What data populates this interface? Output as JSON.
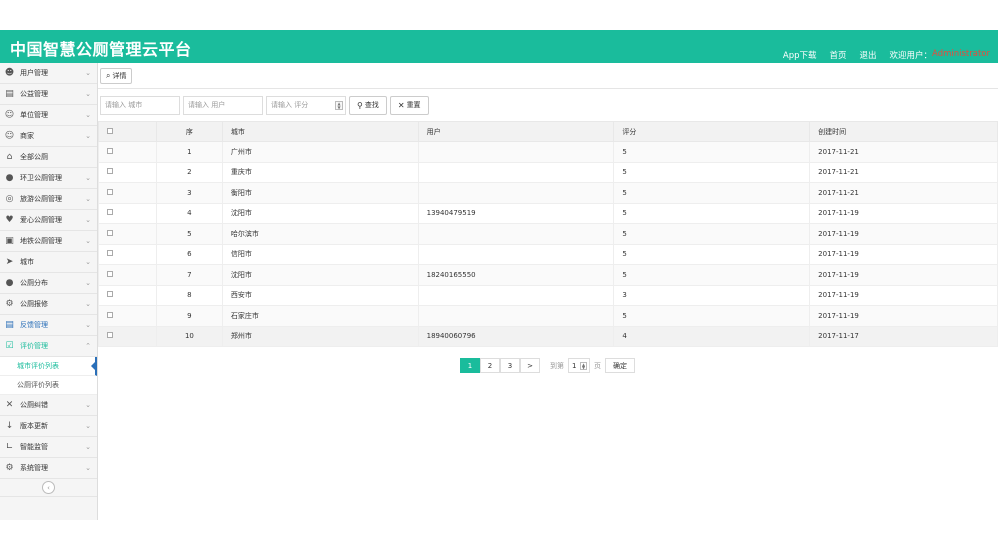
{
  "app": {
    "title": "中国智慧公厕管理云平台",
    "nav": {
      "download": "App下载",
      "home": "首页",
      "logout": "退出",
      "welcome": "欢迎用户：",
      "username": "Administrator"
    }
  },
  "colors": {
    "accent": "#1abc9c",
    "user": "#e74c3c",
    "active_marker": "#2a6fb8"
  },
  "sidebar": {
    "items": [
      {
        "label": "用户管理",
        "icon": "user-icon"
      },
      {
        "label": "公益管理",
        "icon": "document-icon"
      },
      {
        "label": "单位管理",
        "icon": "group-icon"
      },
      {
        "label": "商家",
        "icon": "merchant-icon"
      },
      {
        "label": "全部公厕",
        "icon": "home-icon"
      },
      {
        "label": "环卫公厕管理",
        "icon": "worker-icon"
      },
      {
        "label": "旅游公厕管理",
        "icon": "globe-icon"
      },
      {
        "label": "爱心公厕管理",
        "icon": "heart-icon"
      },
      {
        "label": "地铁公厕管理",
        "icon": "truck-icon"
      },
      {
        "label": "城市",
        "icon": "send-icon"
      },
      {
        "label": "公厕分布",
        "icon": "people-icon"
      },
      {
        "label": "公厕报修",
        "icon": "repair-icon"
      },
      {
        "label": "反馈管理",
        "icon": "list-icon"
      },
      {
        "label": "评价管理",
        "icon": "evaluate-icon"
      }
    ],
    "submenu": [
      {
        "label": "城市评价列表"
      },
      {
        "label": "公厕评价列表"
      }
    ],
    "items_after": [
      {
        "label": "公厕纠错",
        "icon": "cross-icon"
      },
      {
        "label": "版本更新",
        "icon": "arrow-down-icon"
      },
      {
        "label": "智能监管",
        "icon": "chart-icon"
      },
      {
        "label": "系统管理",
        "icon": "gear-icon"
      }
    ]
  },
  "toolbar": {
    "detail_label": "详情"
  },
  "search": {
    "city_placeholder": "请输入 城市",
    "user_placeholder": "请输入 用户",
    "score_placeholder": "请输入 评分",
    "search_label": "查找",
    "reset_label": "重置"
  },
  "table": {
    "headers": {
      "seq": "序",
      "city": "城市",
      "user": "用户",
      "score": "评分",
      "created": "创建时间"
    },
    "rows": [
      {
        "seq": "1",
        "city": "广州市",
        "user": "",
        "score": "5",
        "created": "2017-11-21"
      },
      {
        "seq": "2",
        "city": "重庆市",
        "user": "",
        "score": "5",
        "created": "2017-11-21"
      },
      {
        "seq": "3",
        "city": "衡阳市",
        "user": "",
        "score": "5",
        "created": "2017-11-21"
      },
      {
        "seq": "4",
        "city": "沈阳市",
        "user": "13940479519",
        "score": "5",
        "created": "2017-11-19"
      },
      {
        "seq": "5",
        "city": "哈尔滨市",
        "user": "",
        "score": "5",
        "created": "2017-11-19"
      },
      {
        "seq": "6",
        "city": "信阳市",
        "user": "",
        "score": "5",
        "created": "2017-11-19"
      },
      {
        "seq": "7",
        "city": "沈阳市",
        "user": "18240165550",
        "score": "5",
        "created": "2017-11-19"
      },
      {
        "seq": "8",
        "city": "西安市",
        "user": "",
        "score": "3",
        "created": "2017-11-19"
      },
      {
        "seq": "9",
        "city": "石家庄市",
        "user": "",
        "score": "5",
        "created": "2017-11-19"
      },
      {
        "seq": "10",
        "city": "郑州市",
        "user": "18940060796",
        "score": "4",
        "created": "2017-11-17"
      }
    ]
  },
  "pager": {
    "pages": [
      "1",
      "2",
      "3"
    ],
    "next": ">",
    "goto_prefix": "到第",
    "goto_value": "1",
    "goto_suffix": "页",
    "confirm": "确定"
  }
}
